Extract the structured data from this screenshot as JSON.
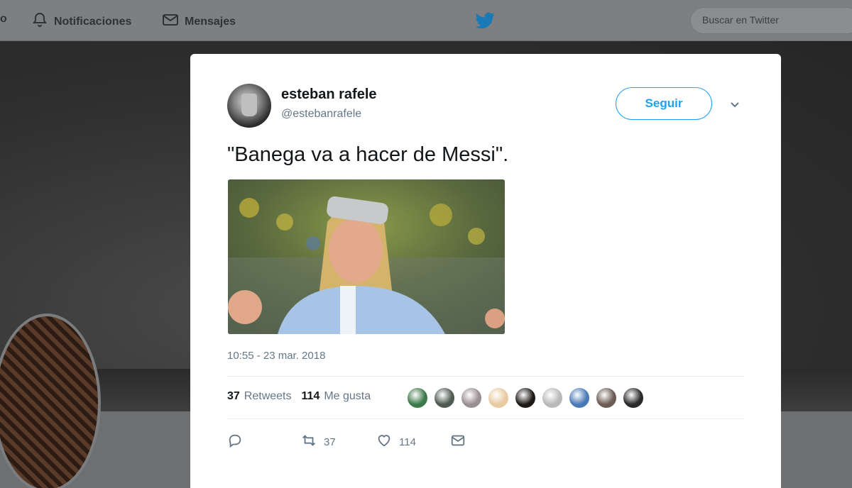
{
  "nav": {
    "home_fragment": "o",
    "notifications_label": "Notificaciones",
    "messages_label": "Mensajes",
    "search_placeholder": "Buscar en Twitter"
  },
  "tweet": {
    "author_name": "esteban rafele",
    "author_handle": "@estebanrafele",
    "follow_label": "Seguir",
    "text": "\"Banega va a hacer de Messi\".",
    "timestamp": "10:55 - 23 mar. 2018",
    "retweets_count": "37",
    "retweets_label": "Retweets",
    "likes_count": "114",
    "likes_label": "Me gusta",
    "action_retweet_count": "37",
    "action_like_count": "114",
    "liker_colors": [
      "#3d7a4a",
      "#4f5a52",
      "#9a8f92",
      "#e8c9a0",
      "#1e1a18",
      "#b9b9b9",
      "#4a7ab5",
      "#6b5b52",
      "#2a2a2a"
    ]
  },
  "colors": {
    "accent": "#1da1f2",
    "text_primary": "#14171a",
    "text_secondary": "#657786"
  },
  "icons": [
    "bell-icon",
    "mail-icon",
    "twitter-bird-icon",
    "chevron-down-icon",
    "reply-icon",
    "retweet-icon",
    "heart-icon",
    "direct-message-icon"
  ]
}
